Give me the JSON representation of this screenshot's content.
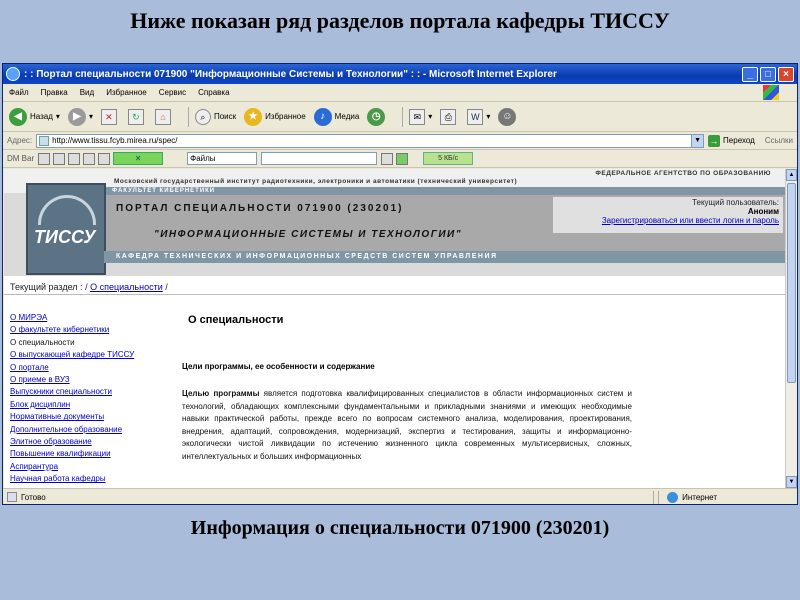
{
  "slide": {
    "title": "Ниже показан ряд разделов портала кафедры ТИССУ",
    "caption": "Информация о специальности 071900 (230201)"
  },
  "browser": {
    "window_title": ": : Портал специальности 071900 \"Информационные Системы и Технологии\" : : - Microsoft Internet Explorer",
    "window_controls": [
      "_",
      "□",
      "×"
    ],
    "menu": [
      "Файл",
      "Правка",
      "Вид",
      "Избранное",
      "Сервис",
      "Справка"
    ],
    "toolbar": {
      "back": "Назад",
      "search": "Поиск",
      "favorites": "Избранное",
      "media": "Медиа"
    },
    "address": {
      "label": "Адрес:",
      "url": "http://www.tissu.fcyb.mirea.ru/spec/",
      "go": "Переход",
      "links": "Ссылки"
    },
    "dmbar": {
      "label": "DM Bar",
      "files": "Файлы",
      "progress": "5 КБ/с"
    },
    "status": {
      "left": "Готово",
      "zone": "Интернет"
    }
  },
  "site": {
    "agency": "ФЕДЕРАЛЬНОЕ АГЕНТСТВО ПО ОБРАЗОВАНИЮ",
    "university": "Московский государственный институт радиотехники, электроники и автоматики (технический университет)",
    "faculty": "ФАКУЛЬТЕТ КИБЕРНЕТИКИ",
    "logo_text": "ТИССУ",
    "portal_title": "ПОРТАЛ СПЕЦИАЛЬНОСТИ 071900 (230201)",
    "portal_subtitle": "\"ИНФОРМАЦИОННЫЕ СИСТЕМЫ И ТЕХНОЛОГИИ\"",
    "department": "КАФЕДРА ТЕХНИЧЕСКИХ И ИНФОРМАЦИОННЫХ СРЕДСТВ СИСТЕМ УПРАВЛЕНИЯ",
    "user_label": "Текущий пользователь:",
    "user_name": "Аноним",
    "user_link": "Зарегистрироваться или ввести логин и пароль",
    "breadcrumb_label": "Текущий раздел :",
    "breadcrumb_sep1": "/",
    "breadcrumb_link": "О специальности",
    "breadcrumb_sep2": "/",
    "nav": [
      {
        "label": "О МИРЭА",
        "active": false
      },
      {
        "label": "О факультете кибернетики",
        "active": false
      },
      {
        "label": "О специальности",
        "active": true
      },
      {
        "label": "О выпускающей кафедре ТИССУ",
        "active": false
      },
      {
        "label": "О портале",
        "active": false
      },
      {
        "label": "О приеме в ВУЗ",
        "active": false
      },
      {
        "label": "Выпускники специальности",
        "active": false
      },
      {
        "label": "Блок дисциплин",
        "active": false
      },
      {
        "label": "Нормативные документы",
        "active": false
      },
      {
        "label": "Дополнительное образование",
        "active": false
      },
      {
        "label": "Элитное образование",
        "active": false
      },
      {
        "label": "Повышение квалификации",
        "active": false
      },
      {
        "label": "Аспирантура",
        "active": false
      },
      {
        "label": "Научная работа кафедры",
        "active": false
      }
    ],
    "main": {
      "heading": "О специальности",
      "subheading": "Цели программы, ее особенности и содержание",
      "lead": "Целью программы",
      "body": " является подготовка квалифицированных специалистов в области информационных систем и технологий, обладающих комплексными фундаментальными и прикладными знаниями и имеющих необходимые навыки практической работы, прежде всего по вопросам системного анализа, моделирования, проектирования, внедрения, адаптаций, сопровождения, модернизаций, экспертиз и тестирования, защиты и информационно-экологически чистой ликвидации по истечению жизненного цикла современных мультисервисных, сложных, интеллектуальных и больших информационных"
    }
  }
}
